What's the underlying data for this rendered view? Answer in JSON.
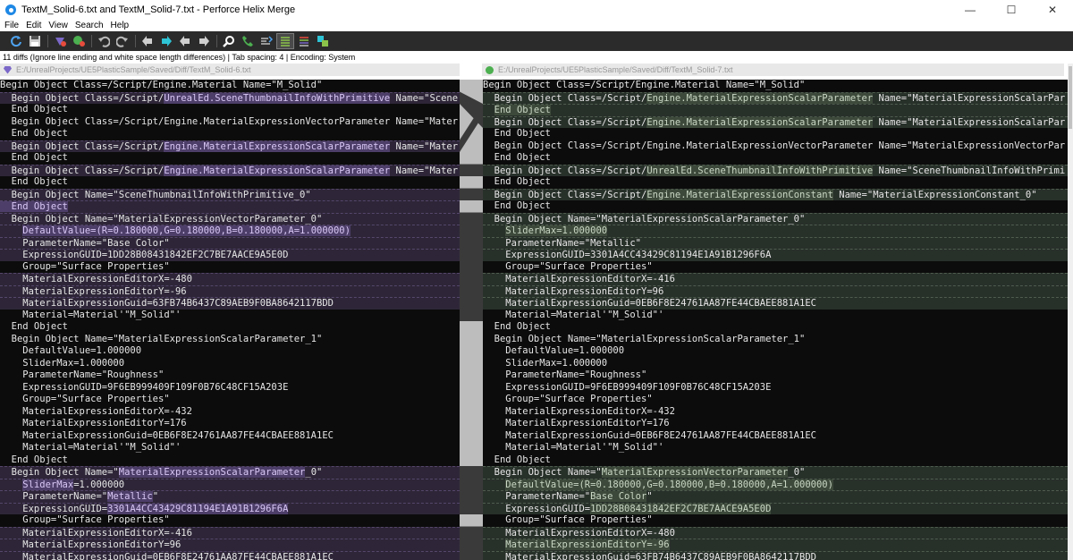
{
  "window": {
    "title": "TextM_Solid-6.txt and TextM_Solid-7.txt - Perforce Helix Merge",
    "minimize": "—",
    "maximize": "☐",
    "close": "✕"
  },
  "menu": [
    "File",
    "Edit",
    "View",
    "Search",
    "Help"
  ],
  "toolbar": [
    "refresh-icon",
    "save-icon",
    "diff-left-icon",
    "diff-right-icon",
    "undo-icon",
    "redo-icon",
    "previous-diff-icon",
    "next-diff-icon",
    "previous-conflict-icon",
    "next-conflict-icon",
    "find-icon",
    "phone-icon",
    "whitespace-icon",
    "line-view-icon",
    "inline-view-icon",
    "merge-view-icon"
  ],
  "status": {
    "text": "11 diffs (Ignore line ending and white space length differences) | Tab spacing: 4 | Encoding: System"
  },
  "left_file": {
    "path": "E:/UnrealProjects/UE5PlasticSample/Saved/Diff/TextM_Solid-6.txt"
  },
  "right_file": {
    "path": "E:/UnrealProjects/UE5PlasticSample/Saved/Diff/TextM_Solid-7.txt"
  },
  "colors": {
    "left_diff_bg": "#2e2638",
    "right_diff_bg": "#28302a",
    "left_highlight": "#4d3e69",
    "right_highlight": "#3d4a3b",
    "pane_bg": "#0c0c0c",
    "toolbar_bg": "#2b2b2b"
  },
  "left_lines": [
    {
      "pre": "Begin Object Class=/Script/Engine.Material Name=\"M_Solid\"",
      "hl": "",
      "post": "",
      "diff": false
    },
    {
      "pre": "  Begin Object Class=/Script/",
      "hl": "UnrealEd.SceneThumbnailInfoWithPrimitive",
      "post": " Name=\"Scene",
      "diff": true
    },
    {
      "pre": "  End Object",
      "hl": "",
      "post": "",
      "diff": false
    },
    {
      "pre": "  Begin Object Class=/Script/Engine.MaterialExpressionVectorParameter Name=\"Mater",
      "hl": "",
      "post": "",
      "diff": false
    },
    {
      "pre": "  End Object",
      "hl": "",
      "post": "",
      "diff": false
    },
    {
      "pre": "  Begin Object Class=/Script/",
      "hl": "Engine.MaterialExpressionScalarParameter",
      "post": " Name=\"Mater",
      "diff": true
    },
    {
      "pre": "  End Object",
      "hl": "",
      "post": "",
      "diff": false
    },
    {
      "pre": "  Begin Object Class=/Script/",
      "hl": "Engine.MaterialExpressionScalarParameter",
      "post": " Name=\"Mater",
      "diff": true
    },
    {
      "pre": "  End Object",
      "hl": "",
      "post": "",
      "diff": false
    },
    {
      "pre": "  Begin Object Name=\"SceneThumbnailInfoWithPrimitive_0\"",
      "hl": "",
      "post": "",
      "diff": true
    },
    {
      "pre": "",
      "hl": "  End Object",
      "post": "",
      "diff": true
    },
    {
      "pre": "  Begin Object Name=\"MaterialExpressionVectorParameter_0\"",
      "hl": "",
      "post": "",
      "diff": true
    },
    {
      "pre": "    ",
      "hl": "DefaultValue=(R=0.180000,G=0.180000,B=0.180000,A=1.000000)",
      "post": "",
      "diff": true
    },
    {
      "pre": "    ParameterName=\"Base Color\"",
      "hl": "",
      "post": "",
      "diff": true
    },
    {
      "pre": "    ExpressionGUID=1DD28B08431842EF2C7BE7AACE9A5E0D",
      "hl": "",
      "post": "",
      "diff": true
    },
    {
      "pre": "    Group=\"Surface Properties\"",
      "hl": "",
      "post": "",
      "diff": false
    },
    {
      "pre": "    MaterialExpressionEditorX=-480",
      "hl": "",
      "post": "",
      "diff": true
    },
    {
      "pre": "    MaterialExpressionEditorY=-96",
      "hl": "",
      "post": "",
      "diff": true
    },
    {
      "pre": "    MaterialExpressionGuid=63FB74B6437C89AEB9F0BA8642117BDD",
      "hl": "",
      "post": "",
      "diff": true
    },
    {
      "pre": "    Material=Material'\"M_Solid\"'",
      "hl": "",
      "post": "",
      "diff": false
    },
    {
      "pre": "  End Object",
      "hl": "",
      "post": "",
      "diff": false
    },
    {
      "pre": "  Begin Object Name=\"MaterialExpressionScalarParameter_1\"",
      "hl": "",
      "post": "",
      "diff": false
    },
    {
      "pre": "    DefaultValue=1.000000",
      "hl": "",
      "post": "",
      "diff": false
    },
    {
      "pre": "    SliderMax=1.000000",
      "hl": "",
      "post": "",
      "diff": false
    },
    {
      "pre": "    ParameterName=\"Roughness\"",
      "hl": "",
      "post": "",
      "diff": false
    },
    {
      "pre": "    ExpressionGUID=9F6EB999409F109F0B76C48CF15A203E",
      "hl": "",
      "post": "",
      "diff": false
    },
    {
      "pre": "    Group=\"Surface Properties\"",
      "hl": "",
      "post": "",
      "diff": false
    },
    {
      "pre": "    MaterialExpressionEditorX=-432",
      "hl": "",
      "post": "",
      "diff": false
    },
    {
      "pre": "    MaterialExpressionEditorY=176",
      "hl": "",
      "post": "",
      "diff": false
    },
    {
      "pre": "    MaterialExpressionGuid=0EB6F8E24761AA87FE44CBAEE881A1EC",
      "hl": "",
      "post": "",
      "diff": false
    },
    {
      "pre": "    Material=Material'\"M_Solid\"'",
      "hl": "",
      "post": "",
      "diff": false
    },
    {
      "pre": "  End Object",
      "hl": "",
      "post": "",
      "diff": false
    },
    {
      "pre": "  Begin Object Name=\"",
      "hl": "MaterialExpressionScalarParameter",
      "post": "_0\"",
      "diff": true
    },
    {
      "pre": "    ",
      "hl": "SliderMax",
      "post": "=1.000000",
      "diff": true
    },
    {
      "pre": "    ParameterName=\"",
      "hl": "Metallic",
      "post": "\"",
      "diff": true
    },
    {
      "pre": "    ExpressionGUID=",
      "hl": "3301A4CC43429C81194E1A91B1296F6A",
      "post": "",
      "diff": true
    },
    {
      "pre": "    Group=\"Surface Properties\"",
      "hl": "",
      "post": "",
      "diff": false
    },
    {
      "pre": "    MaterialExpressionEditorX=-416",
      "hl": "",
      "post": "",
      "diff": true
    },
    {
      "pre": "    MaterialExpressionEditorY=96",
      "hl": "",
      "post": "",
      "diff": true
    },
    {
      "pre": "    MaterialExpressionGuid=0EB6F8E24761AA87FE44CBAEE881A1EC",
      "hl": "",
      "post": "",
      "diff": true
    }
  ],
  "right_lines": [
    {
      "pre": "Begin Object Class=/Script/Engine.Material Name=\"M_Solid\"",
      "hl": "",
      "post": "",
      "diff": false
    },
    {
      "pre": "  Begin Object Class=/Script/",
      "hl": "Engine.MaterialExpressionScalarParameter",
      "post": " Name=\"MaterialExpressionScalarPar",
      "diff": true
    },
    {
      "pre": "  ",
      "hl": "End Object",
      "post": "",
      "diff": true
    },
    {
      "pre": "  Begin Object Class=/Script/",
      "hl": "Engine.MaterialExpressionScalarParameter",
      "post": " Name=\"MaterialExpressionScalarPar",
      "diff": true
    },
    {
      "pre": "  End Object",
      "hl": "",
      "post": "",
      "diff": false
    },
    {
      "pre": "  Begin Object Class=/Script/Engine.MaterialExpressionVectorParameter Name=\"MaterialExpressionVectorPar",
      "hl": "",
      "post": "",
      "diff": false
    },
    {
      "pre": "  End Object",
      "hl": "",
      "post": "",
      "diff": false
    },
    {
      "pre": "  Begin Object Class=/Script/",
      "hl": "UnrealEd.SceneThumbnailInfoWithPrimitive",
      "post": " Name=\"SceneThumbnailInfoWithPrimi",
      "diff": true
    },
    {
      "pre": "  End Object",
      "hl": "",
      "post": "",
      "diff": false
    },
    {
      "pre": "  Begin Object Class=/Script/",
      "hl": "Engine.MaterialExpressionConstant",
      "post": " Name=\"MaterialExpressionConstant_0\"",
      "diff": true
    },
    {
      "pre": "  End Object",
      "hl": "",
      "post": "",
      "diff": false
    },
    {
      "pre": "  Begin Object Name=\"MaterialExpressionScalarParameter_0\"",
      "hl": "",
      "post": "",
      "diff": true
    },
    {
      "pre": "    ",
      "hl": "SliderMax=1.000000",
      "post": "",
      "diff": true
    },
    {
      "pre": "    ParameterName=\"Metallic\"",
      "hl": "",
      "post": "",
      "diff": true
    },
    {
      "pre": "    ExpressionGUID=3301A4CC43429C81194E1A91B1296F6A",
      "hl": "",
      "post": "",
      "diff": true
    },
    {
      "pre": "    Group=\"Surface Properties\"",
      "hl": "",
      "post": "",
      "diff": false
    },
    {
      "pre": "    MaterialExpressionEditorX=-416",
      "hl": "",
      "post": "",
      "diff": true
    },
    {
      "pre": "    MaterialExpressionEditorY=96",
      "hl": "",
      "post": "",
      "diff": true
    },
    {
      "pre": "    MaterialExpressionGuid=0EB6F8E24761AA87FE44CBAEE881A1EC",
      "hl": "",
      "post": "",
      "diff": true
    },
    {
      "pre": "    Material=Material'\"M_Solid\"'",
      "hl": "",
      "post": "",
      "diff": false
    },
    {
      "pre": "  End Object",
      "hl": "",
      "post": "",
      "diff": false
    },
    {
      "pre": "  Begin Object Name=\"MaterialExpressionScalarParameter_1\"",
      "hl": "",
      "post": "",
      "diff": false
    },
    {
      "pre": "    DefaultValue=1.000000",
      "hl": "",
      "post": "",
      "diff": false
    },
    {
      "pre": "    SliderMax=1.000000",
      "hl": "",
      "post": "",
      "diff": false
    },
    {
      "pre": "    ParameterName=\"Roughness\"",
      "hl": "",
      "post": "",
      "diff": false
    },
    {
      "pre": "    ExpressionGUID=9F6EB999409F109F0B76C48CF15A203E",
      "hl": "",
      "post": "",
      "diff": false
    },
    {
      "pre": "    Group=\"Surface Properties\"",
      "hl": "",
      "post": "",
      "diff": false
    },
    {
      "pre": "    MaterialExpressionEditorX=-432",
      "hl": "",
      "post": "",
      "diff": false
    },
    {
      "pre": "    MaterialExpressionEditorY=176",
      "hl": "",
      "post": "",
      "diff": false
    },
    {
      "pre": "    MaterialExpressionGuid=0EB6F8E24761AA87FE44CBAEE881A1EC",
      "hl": "",
      "post": "",
      "diff": false
    },
    {
      "pre": "    Material=Material'\"M_Solid\"'",
      "hl": "",
      "post": "",
      "diff": false
    },
    {
      "pre": "  End Object",
      "hl": "",
      "post": "",
      "diff": false
    },
    {
      "pre": "  Begin Object Name=\"",
      "hl": "MaterialExpressionVectorParameter",
      "post": "_0\"",
      "diff": true
    },
    {
      "pre": "    ",
      "hl": "DefaultValue=(R=0.180000,G=0.180000,B=0.180000,A=1.000000)",
      "post": "",
      "diff": true
    },
    {
      "pre": "    ParameterName=\"",
      "hl": "Base Color",
      "post": "\"",
      "diff": true
    },
    {
      "pre": "    ExpressionGUID=",
      "hl": "1DD28B08431842EF2C7BE7AACE9A5E0D",
      "post": "",
      "diff": true
    },
    {
      "pre": "    Group=\"Surface Properties\"",
      "hl": "",
      "post": "",
      "diff": false
    },
    {
      "pre": "    MaterialExpressionEditorX=-480",
      "hl": "",
      "post": "",
      "diff": true
    },
    {
      "pre": "    ",
      "hl": "MaterialExpressionEditorY=-96",
      "post": "",
      "diff": true
    },
    {
      "pre": "    MaterialExpressionGuid=63FB74B6437C89AEB9F0BA8642117BDD",
      "hl": "",
      "post": "",
      "diff": true
    }
  ]
}
